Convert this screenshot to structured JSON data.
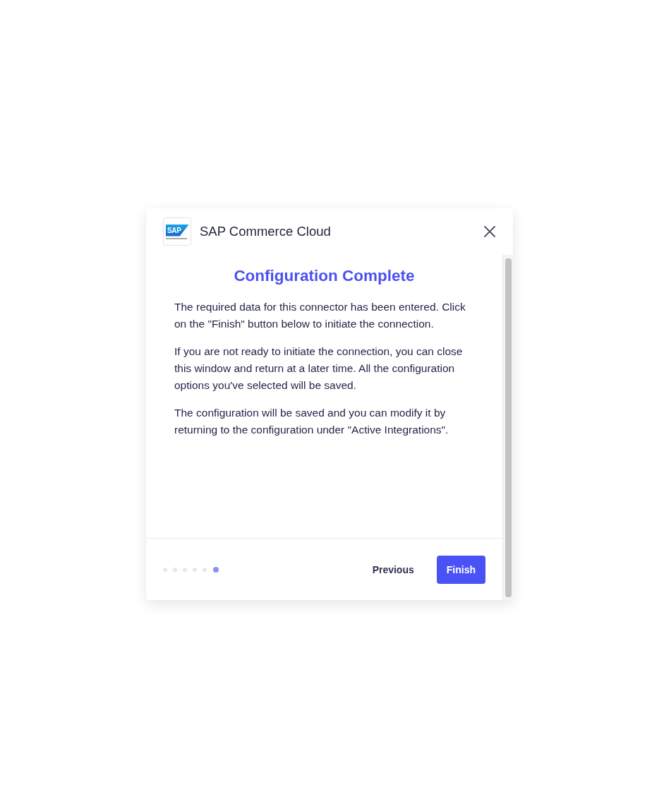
{
  "header": {
    "logo": {
      "mark": "SAP"
    },
    "title": "SAP Commerce Cloud"
  },
  "content": {
    "heading": "Configuration Complete",
    "paragraphs": [
      "The required data for this connector has been entered. Click on the \"Finish\" button below to initiate the connection.",
      "If you are not ready to initiate the connection, you can close this window and return at a later time. All the configuration options you've selected will be saved.",
      "The configuration will be saved and you can modify it by returning to the configuration under \"Active Integrations\"."
    ]
  },
  "footer": {
    "steps": [
      {
        "selected": false
      },
      {
        "selected": false
      },
      {
        "selected": false
      },
      {
        "selected": false
      },
      {
        "selected": false
      },
      {
        "selected": true
      }
    ],
    "buttons": [
      {
        "kind": "secondary",
        "label": "Previous"
      },
      {
        "kind": "primary",
        "label": "Finish"
      }
    ]
  }
}
